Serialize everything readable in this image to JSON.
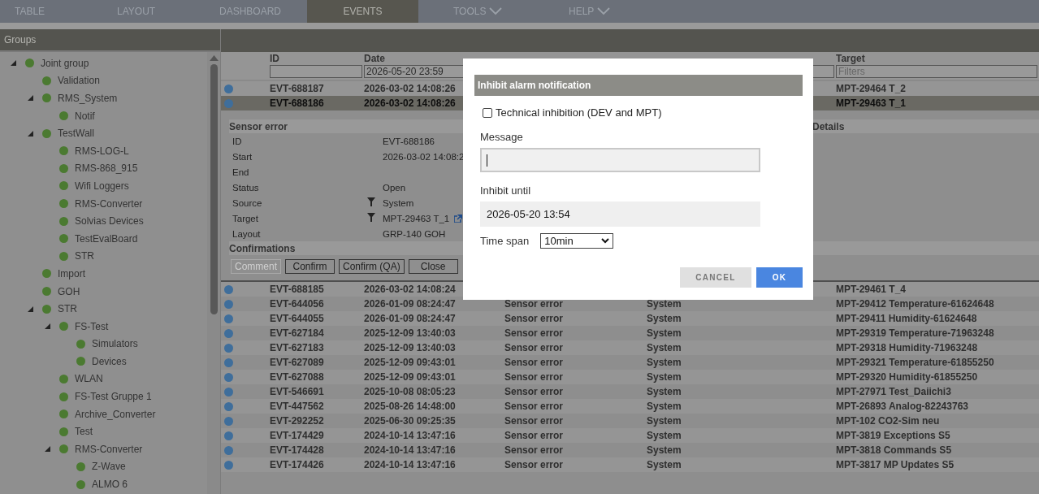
{
  "nav": [
    {
      "label": "TABLE",
      "selected": false,
      "menu": false
    },
    {
      "label": "LAYOUT",
      "selected": false,
      "menu": false
    },
    {
      "label": "DASHBOARD",
      "selected": false,
      "menu": false
    },
    {
      "label": "EVENTS",
      "selected": true,
      "menu": false
    },
    {
      "label": "TOOLS",
      "selected": false,
      "menu": true
    },
    {
      "label": "HELP",
      "selected": false,
      "menu": true
    }
  ],
  "groups": {
    "title": "Groups",
    "tree": [
      {
        "label": "Joint group",
        "expanded": true,
        "children": [
          {
            "label": "Validation"
          },
          {
            "label": "RMS_System",
            "expanded": true,
            "children": [
              {
                "label": "Notif"
              }
            ]
          },
          {
            "label": "TestWall",
            "expanded": true,
            "children": [
              {
                "label": "RMS-LOG-L"
              },
              {
                "label": "RMS-868_915"
              },
              {
                "label": "Wifi Loggers"
              },
              {
                "label": "RMS-Converter"
              },
              {
                "label": "Solvias Devices"
              },
              {
                "label": "TestEvalBoard"
              },
              {
                "label": "STR"
              }
            ]
          },
          {
            "label": "Import"
          },
          {
            "label": "GOH"
          },
          {
            "label": "STR",
            "expanded": true,
            "children": [
              {
                "label": "FS-Test",
                "expanded": true,
                "children": [
                  {
                    "label": "Simulators"
                  },
                  {
                    "label": "Devices"
                  }
                ]
              },
              {
                "label": "WLAN"
              },
              {
                "label": "FS-Test Gruppe 1"
              },
              {
                "label": "Archive_Converter"
              },
              {
                "label": "Test"
              },
              {
                "label": "RMS-Converter",
                "expanded": true,
                "children": [
                  {
                    "label": "Z-Wave"
                  },
                  {
                    "label": "ALMO 6"
                  }
                ]
              }
            ]
          }
        ]
      }
    ]
  },
  "events": {
    "columns": [
      {
        "label": "ID"
      },
      {
        "label": "Date",
        "filter": "2026-05-20 23:59"
      },
      {},
      {
        "kind": "filter"
      },
      {
        "label": "Target",
        "placeholder": "Filters"
      }
    ],
    "rows": [
      {
        "id": "EVT-688187",
        "date": "2026-03-02 14:08:26",
        "target": "MPT-29464 T_2",
        "selected": false
      },
      {
        "id": "EVT-688186",
        "date": "2026-03-02 14:08:26",
        "target": "MPT-29463 T_1",
        "selected": true
      },
      {
        "id": "EVT-688185",
        "date": "2026-03-02 14:08:24",
        "target": "MPT-29461 T_4",
        "selected": false
      },
      {
        "id": "EVT-644056",
        "date": "2026-01-09 08:24:47",
        "event": "Sensor error",
        "source": "System",
        "target": "MPT-29412 Temperature-61624648",
        "selected": false
      },
      {
        "id": "EVT-644055",
        "date": "2026-01-09 08:24:47",
        "event": "Sensor error",
        "source": "System",
        "target": "MPT-29411 Humidity-61624648",
        "selected": false
      },
      {
        "id": "EVT-627184",
        "date": "2025-12-09 13:40:03",
        "event": "Sensor error",
        "source": "System",
        "target": "MPT-29319 Temperature-71963248",
        "selected": false
      },
      {
        "id": "EVT-627183",
        "date": "2025-12-09 13:40:03",
        "event": "Sensor error",
        "source": "System",
        "target": "MPT-29318 Humidity-71963248",
        "selected": false
      },
      {
        "id": "EVT-627089",
        "date": "2025-12-09 09:43:01",
        "event": "Sensor error",
        "source": "System",
        "target": "MPT-29321 Temperature-61855250",
        "selected": false
      },
      {
        "id": "EVT-627088",
        "date": "2025-12-09 09:43:01",
        "event": "Sensor error",
        "source": "System",
        "target": "MPT-29320 Humidity-61855250",
        "selected": false
      },
      {
        "id": "EVT-546691",
        "date": "2025-10-08 08:05:23",
        "event": "Sensor error",
        "source": "System",
        "target": "MPT-27971 Test_Daiichi3",
        "selected": false
      },
      {
        "id": "EVT-447562",
        "date": "2025-08-26 14:48:00",
        "event": "Sensor error",
        "source": "System",
        "target": "MPT-26893 Analog-82243763",
        "selected": false
      },
      {
        "id": "EVT-292252",
        "date": "2025-06-30 09:25:35",
        "event": "Sensor error",
        "source": "System",
        "target": "MPT-102 CO2-Sim neu",
        "selected": false
      },
      {
        "id": "EVT-174429",
        "date": "2024-10-14 13:47:16",
        "event": "Sensor error",
        "source": "System",
        "target": "MPT-3819 Exceptions S5",
        "selected": false
      },
      {
        "id": "EVT-174428",
        "date": "2024-10-14 13:47:16",
        "event": "Sensor error",
        "source": "System",
        "target": "MPT-3818 Commands S5",
        "selected": false
      },
      {
        "id": "EVT-174426",
        "date": "2024-10-14 13:47:16",
        "event": "Sensor error",
        "source": "System",
        "target": "MPT-3817 MP Updates S5",
        "selected": false
      }
    ],
    "detail": {
      "title": "Sensor error",
      "side_title": "Details",
      "fields": [
        {
          "label": "ID",
          "value": "EVT-688186"
        },
        {
          "label": "Start",
          "value": "2026-03-02 14:08:2"
        },
        {
          "label": "End"
        },
        {
          "label": "Status",
          "value": "Open"
        },
        {
          "label": "Source",
          "value": "System",
          "filter": true
        },
        {
          "label": "Target",
          "value": "MPT-29463 T_1",
          "filter": true,
          "link": true
        },
        {
          "label": "Layout",
          "value": "GRP-140 GOH"
        }
      ],
      "confirmations_title": "Confirmations",
      "buttons": [
        {
          "label": "Comment",
          "disabled": true
        },
        {
          "label": "Confirm",
          "disabled": false
        },
        {
          "label": "Confirm (QA)",
          "disabled": false
        },
        {
          "label": "Close",
          "disabled": false
        }
      ]
    }
  },
  "dialog": {
    "title": "Inhibit alarm notification",
    "technical": {
      "label": "Technical inhibition (DEV and MPT)",
      "checked": false
    },
    "message": {
      "label": "Message"
    },
    "until": {
      "label": "Inhibit until",
      "value": "2026-05-20 13:54"
    },
    "timespan": {
      "label": "Time span",
      "value": "10min"
    },
    "buttons": [
      {
        "label": "CANCEL",
        "kind": "secondary"
      },
      {
        "label": "OK",
        "kind": "primary"
      }
    ]
  }
}
